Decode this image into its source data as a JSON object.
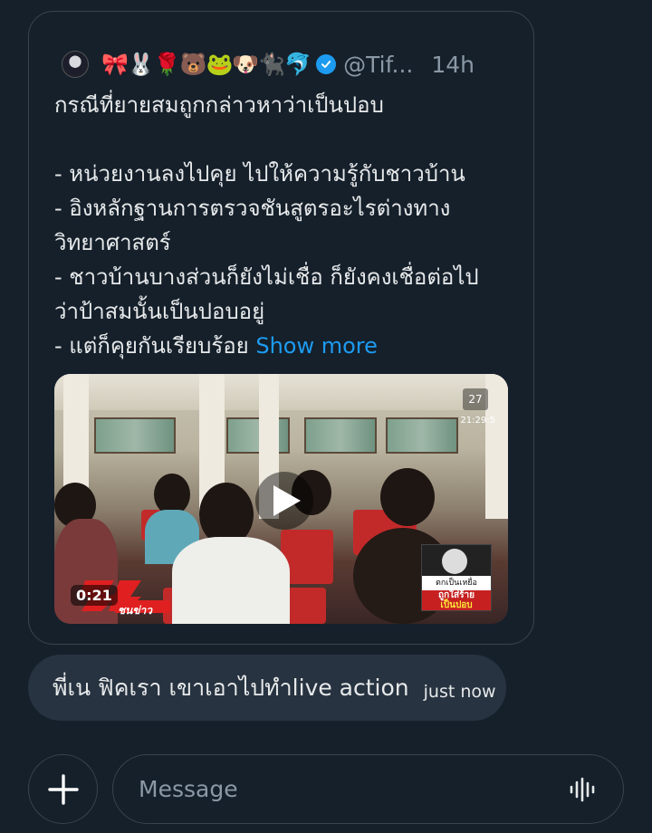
{
  "quoted_tweet": {
    "author_emoji_name": "🎀🐰🌹🐻🐸🐶🐈‍⬛🐬",
    "handle": "@Tif...",
    "time": "14h",
    "text_lines": [
      "กรณีที่ยายสมถูกกล่าวหาว่าเป็นปอบ",
      "",
      "- หน่วยงานลงไปคุย ไปให้ความรู้กับชาวบ้าน",
      "- อิงหลักฐานการตรวจชันสูตรอะไรต่างทาง",
      "วิทยาศาสตร์",
      "- ชาวบ้านบางส่วนก็ยังไม่เชื่อ ก็ยังคงเชื่อต่อไป",
      "ว่าป้าสมนั้นเป็นปอบอยู่"
    ],
    "last_line": "- แต่ก็คุยกันเรียบร้อย",
    "show_more": "Show more",
    "video": {
      "duration": "0:21",
      "overlay_day": "27",
      "overlay_time": "21:29:5",
      "logo_text": "ชนข่าว",
      "inset_caption_1": "ตกเป็นเหยื่อ",
      "inset_caption_2": "ถูกใส่ร้าย",
      "inset_caption_3": "เป็นปอบ"
    }
  },
  "message": {
    "text": "พี่เน ฟิคเรา เขาเอาไปทำlive action",
    "time": "just now"
  },
  "composer": {
    "placeholder": "Message"
  },
  "colors": {
    "background": "#15202b",
    "bubble": "#273340",
    "accent": "#1d9bf0",
    "border": "#38444d"
  }
}
